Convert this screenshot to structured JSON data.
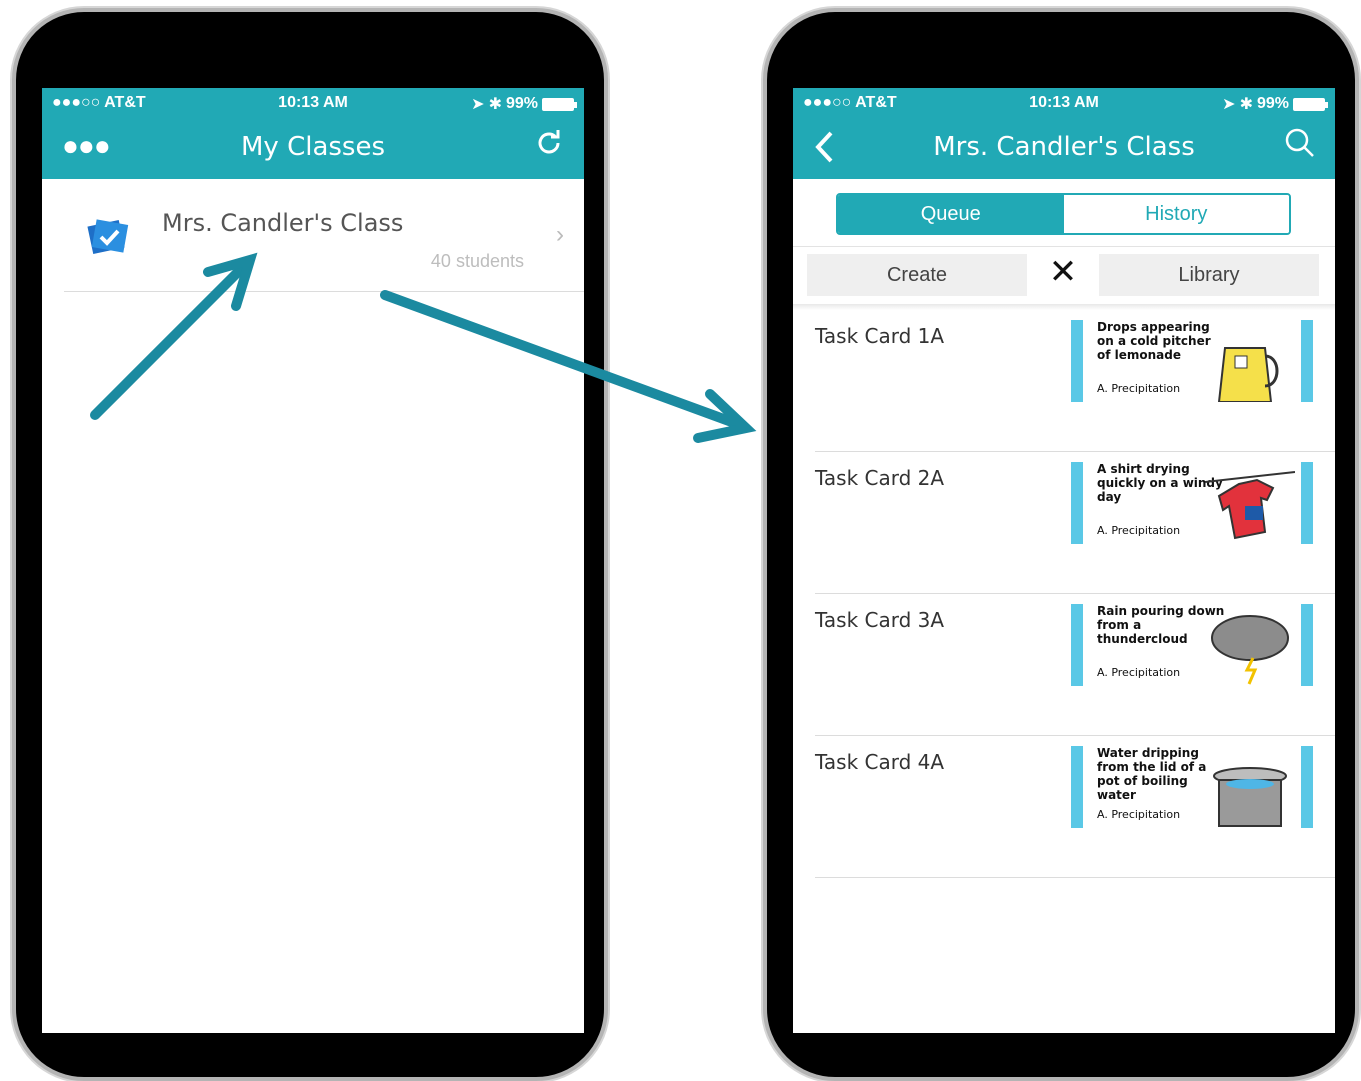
{
  "status_bar": {
    "carrier": "●●●○○ AT&T",
    "time": "10:13 AM",
    "battery": "99%"
  },
  "left_screen": {
    "title": "My Classes",
    "menu_icon": "more-dots-icon",
    "refresh_icon": "refresh-icon",
    "class_item": {
      "name": "Mrs. Candler's Class",
      "students": "40 students"
    }
  },
  "right_screen": {
    "title": "Mrs. Candler's Class",
    "back_icon": "back-chevron-icon",
    "search_icon": "search-icon",
    "tabs": [
      {
        "label": "Queue",
        "active": true
      },
      {
        "label": "History",
        "active": false
      }
    ],
    "toolbar": {
      "create_label": "Create",
      "close_symbol": "✕",
      "library_label": "Library"
    },
    "task_cards": [
      {
        "title": "Task Card 1A",
        "thumb_text": "Drops appearing on a cold pitcher of lemonade",
        "thumb_answer": "A. Precipitation"
      },
      {
        "title": "Task Card 2A",
        "thumb_text": "A shirt drying quickly on a windy day",
        "thumb_answer": "A. Precipitation"
      },
      {
        "title": "Task Card 3A",
        "thumb_text": "Rain pouring down from a thundercloud",
        "thumb_answer": "A. Precipitation"
      },
      {
        "title": "Task Card 4A",
        "thumb_text": "Water dripping from the lid of a pot of boiling water",
        "thumb_answer": "A. Precipitation"
      }
    ]
  },
  "colors": {
    "teal": "#21a9b5",
    "arrow": "#1b8aa0"
  }
}
